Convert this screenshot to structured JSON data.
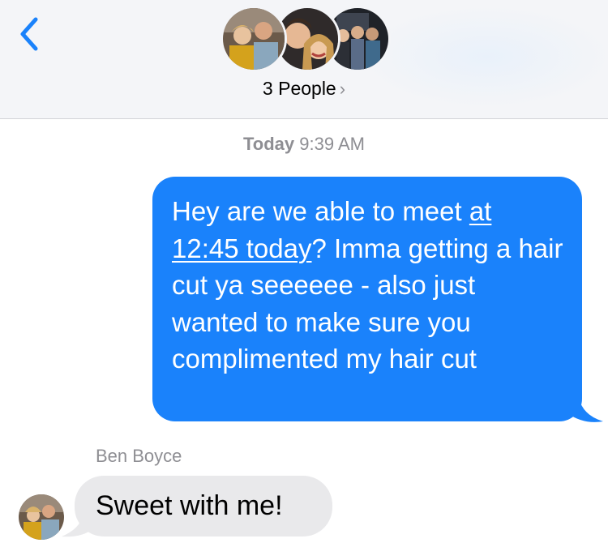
{
  "header": {
    "title": "3 People",
    "title_chevron": "›",
    "back_icon": "chevron-left-icon",
    "accent_color": "#1a82fb"
  },
  "conversation": {
    "timestamp_day": "Today",
    "timestamp_time": "9:39 AM",
    "messages": [
      {
        "direction": "outgoing",
        "text_before_link": "Hey are we able to meet ",
        "link_text": "at 12:45 today",
        "text_after_link": "? Imma getting a hair cut ya seeeeee - also just wanted to make sure you complimented my hair cut",
        "bubble_color": "#1a82fb"
      },
      {
        "direction": "incoming",
        "sender": "Ben Boyce",
        "text": "Sweet with me!",
        "bubble_color": "#e9e9eb"
      }
    ]
  }
}
